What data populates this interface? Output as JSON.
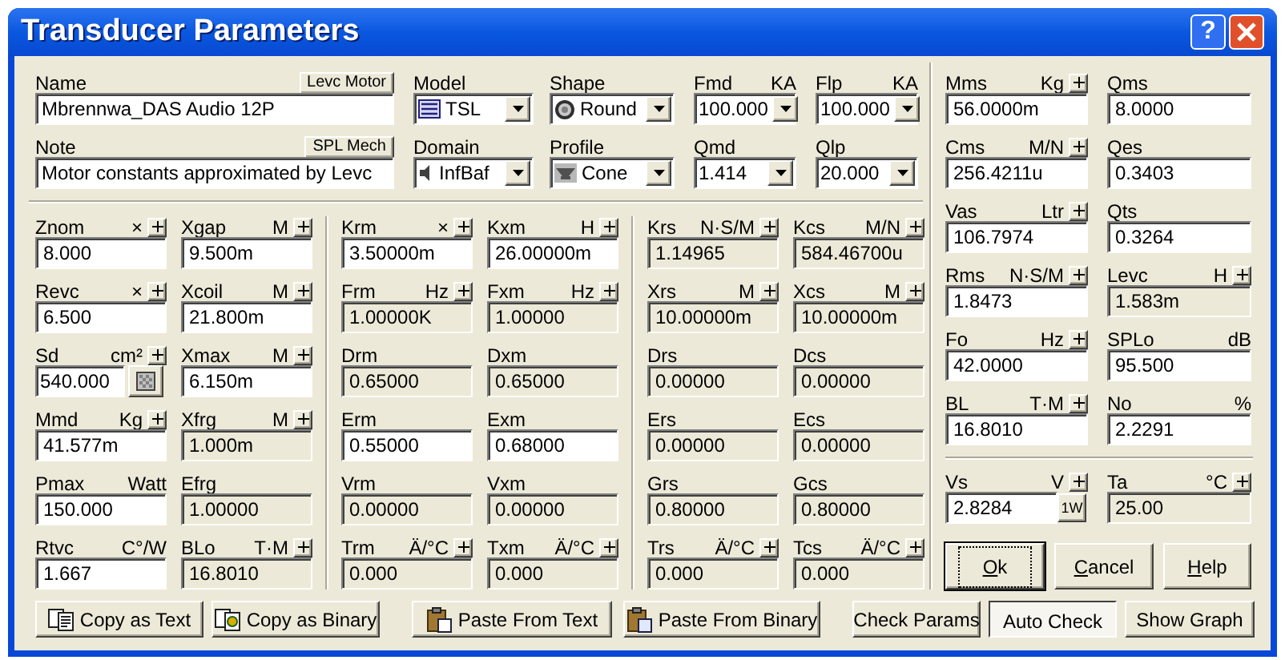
{
  "window": {
    "title": "Transducer Parameters",
    "help_button": "?"
  },
  "name": {
    "label": "Name",
    "button": "Levc Motor",
    "value": "Mbrennwa_DAS Audio 12P"
  },
  "note": {
    "label": "Note",
    "button": "SPL Mech",
    "value": "Motor constants approximated by Levc"
  },
  "model": {
    "label": "Model",
    "value": "TSL"
  },
  "domain": {
    "label": "Domain",
    "value": "InfBaf"
  },
  "shape": {
    "label": "Shape",
    "value": "Round"
  },
  "profile": {
    "label": "Profile",
    "value": "Cone"
  },
  "fmd": {
    "label": "Fmd",
    "unit": "KA",
    "value": "100.000"
  },
  "qmd": {
    "label": "Qmd",
    "value": "1.414"
  },
  "flp": {
    "label": "Flp",
    "unit": "KA",
    "value": "100.000"
  },
  "qlp": {
    "label": "Qlp",
    "value": "20.000"
  },
  "groups": [
    [
      {
        "label": "Znom",
        "unit": "×",
        "spin": true,
        "value": "8.000",
        "editable": true,
        "kind": "field"
      },
      {
        "label": "Xgap",
        "unit": "M",
        "spin": true,
        "value": "9.500m",
        "editable": true,
        "kind": "field"
      },
      {
        "label": "Revc",
        "unit": "×",
        "spin": true,
        "value": "6.500",
        "editable": true,
        "kind": "field"
      },
      {
        "label": "Xcoil",
        "unit": "M",
        "spin": true,
        "value": "21.800m",
        "editable": true,
        "kind": "field"
      },
      {
        "label": "Sd",
        "unit": "cm²",
        "spin": true,
        "value": "540.000",
        "editable": true,
        "kind": "field_icon_button"
      },
      {
        "label": "Xmax",
        "unit": "M",
        "spin": true,
        "value": "6.150m",
        "editable": true,
        "kind": "field"
      },
      {
        "label": "Mmd",
        "unit": "Kg",
        "spin": true,
        "value": "41.577m",
        "editable": true,
        "kind": "field"
      },
      {
        "label": "Xfrg",
        "unit": "M",
        "spin": true,
        "value": "1.000m",
        "editable": false,
        "kind": "field"
      },
      {
        "label": "Pmax",
        "unit": "Watt",
        "spin": false,
        "value": "150.000",
        "editable": true,
        "kind": "field"
      },
      {
        "label": "Efrg",
        "spin": false,
        "value": "1.00000",
        "editable": false,
        "kind": "field"
      },
      {
        "label": "Rtvc",
        "unit": "C°/W",
        "spin": false,
        "value": "1.667",
        "editable": true,
        "kind": "field"
      },
      {
        "label": "BLo",
        "unit": "T·M",
        "spin": true,
        "value": "16.8010",
        "editable": false,
        "kind": "field"
      }
    ],
    [
      {
        "label": "Krm",
        "unit": "×",
        "spin": true,
        "value": "3.50000m",
        "editable": true,
        "kind": "field"
      },
      {
        "label": "Kxm",
        "unit": "H",
        "spin": true,
        "value": "26.00000m",
        "editable": true,
        "kind": "field"
      },
      {
        "label": "Frm",
        "unit": "Hz",
        "spin": true,
        "value": "1.00000K",
        "editable": false,
        "kind": "field"
      },
      {
        "label": "Fxm",
        "unit": "Hz",
        "spin": true,
        "value": "1.00000",
        "editable": false,
        "kind": "field"
      },
      {
        "label": "Drm",
        "spin": false,
        "value": "0.65000",
        "editable": false,
        "kind": "field"
      },
      {
        "label": "Dxm",
        "spin": false,
        "value": "0.65000",
        "editable": false,
        "kind": "field"
      },
      {
        "label": "Erm",
        "spin": false,
        "value": "0.55000",
        "editable": true,
        "kind": "field"
      },
      {
        "label": "Exm",
        "spin": false,
        "value": "0.68000",
        "editable": true,
        "kind": "field"
      },
      {
        "label": "Vrm",
        "spin": false,
        "value": "0.00000",
        "editable": false,
        "kind": "field"
      },
      {
        "label": "Vxm",
        "spin": false,
        "value": "0.00000",
        "editable": false,
        "kind": "field"
      },
      {
        "label": "Trm",
        "unit": "Ä/°C",
        "spin": true,
        "value": "0.000",
        "editable": false,
        "kind": "field"
      },
      {
        "label": "Txm",
        "unit": "Ä/°C",
        "spin": true,
        "value": "0.000",
        "editable": false,
        "kind": "field"
      }
    ],
    [
      {
        "label": "Krs",
        "unit": "N·S/M",
        "spin": true,
        "value": "1.14965",
        "editable": false,
        "kind": "field"
      },
      {
        "label": "Kcs",
        "unit": "M/N",
        "spin": true,
        "value": "584.46700u",
        "editable": false,
        "kind": "field"
      },
      {
        "label": "Xrs",
        "unit": "M",
        "spin": true,
        "value": "10.00000m",
        "editable": false,
        "kind": "field"
      },
      {
        "label": "Xcs",
        "unit": "M",
        "spin": true,
        "value": "10.00000m",
        "editable": false,
        "kind": "field"
      },
      {
        "label": "Drs",
        "spin": false,
        "value": "0.00000",
        "editable": false,
        "kind": "field"
      },
      {
        "label": "Dcs",
        "spin": false,
        "value": "0.00000",
        "editable": false,
        "kind": "field"
      },
      {
        "label": "Ers",
        "spin": false,
        "value": "0.00000",
        "editable": false,
        "kind": "field"
      },
      {
        "label": "Ecs",
        "spin": false,
        "value": "0.00000",
        "editable": false,
        "kind": "field"
      },
      {
        "label": "Grs",
        "spin": false,
        "value": "0.80000",
        "editable": false,
        "kind": "field"
      },
      {
        "label": "Gcs",
        "spin": false,
        "value": "0.80000",
        "editable": false,
        "kind": "field"
      },
      {
        "label": "Trs",
        "unit": "Ä/°C",
        "spin": true,
        "value": "0.000",
        "editable": false,
        "kind": "field"
      },
      {
        "label": "Tcs",
        "unit": "Ä/°C",
        "spin": true,
        "value": "0.000",
        "editable": false,
        "kind": "field"
      }
    ]
  ],
  "driver_params": [
    {
      "label": "Mms",
      "unit": "Kg",
      "spin": true,
      "value": "56.0000m",
      "editable": true,
      "kind": "field"
    },
    {
      "label": "Qms",
      "spin": false,
      "value": "8.0000",
      "editable": true,
      "kind": "field"
    },
    {
      "label": "Cms",
      "unit": "M/N",
      "spin": true,
      "value": "256.4211u",
      "editable": true,
      "kind": "field"
    },
    {
      "label": "Qes",
      "spin": false,
      "value": "0.3403",
      "editable": true,
      "kind": "field"
    },
    {
      "label": "Vas",
      "unit": "Ltr",
      "spin": true,
      "value": "106.7974",
      "editable": true,
      "kind": "field"
    },
    {
      "label": "Qts",
      "spin": false,
      "value": "0.3264",
      "editable": true,
      "kind": "field"
    },
    {
      "label": "Rms",
      "unit": "N·S/M",
      "spin": true,
      "value": "1.8473",
      "editable": true,
      "kind": "field"
    },
    {
      "label": "Levc",
      "unit": "H",
      "spin": true,
      "value": "1.583m",
      "editable": false,
      "kind": "field"
    },
    {
      "label": "Fo",
      "unit": "Hz",
      "spin": true,
      "value": "42.0000",
      "editable": true,
      "kind": "field"
    },
    {
      "label": "SPLo",
      "unit": "dB",
      "spin": false,
      "value": "95.500",
      "editable": true,
      "kind": "field"
    },
    {
      "label": "BL",
      "unit": "T·M",
      "spin": true,
      "value": "16.8010",
      "editable": true,
      "kind": "field"
    },
    {
      "label": "No",
      "unit": "%",
      "spin": false,
      "value": "2.2291",
      "editable": true,
      "kind": "field"
    }
  ],
  "source_params": [
    {
      "label": "Vs",
      "unit": "V",
      "spin": true,
      "value": "2.8284",
      "editable": true,
      "kind": "field_text_button",
      "button": "1W"
    },
    {
      "label": "Ta",
      "unit": "°C",
      "spin": true,
      "value": "25.00",
      "editable": false,
      "kind": "field"
    }
  ],
  "dialog_buttons": [
    {
      "label": "Ok",
      "focused": true
    },
    {
      "label": "Cancel",
      "focused": false
    },
    {
      "label": "Help",
      "focused": false
    }
  ],
  "bottom_buttons": [
    {
      "label": "Copy as Text",
      "kind": "copy_text",
      "pressed": false
    },
    {
      "label": "Copy as Binary",
      "kind": "copy_binary",
      "pressed": false
    },
    {
      "label": "Paste From Text",
      "kind": "paste_text",
      "pressed": false
    },
    {
      "label": "Paste From Binary",
      "kind": "paste_binary",
      "pressed": false
    },
    {
      "label": "Check Params",
      "kind": "plain",
      "pressed": false
    },
    {
      "label": "Auto Check",
      "kind": "plain",
      "pressed": true
    },
    {
      "label": "Show Graph",
      "kind": "plain",
      "pressed": false
    }
  ]
}
